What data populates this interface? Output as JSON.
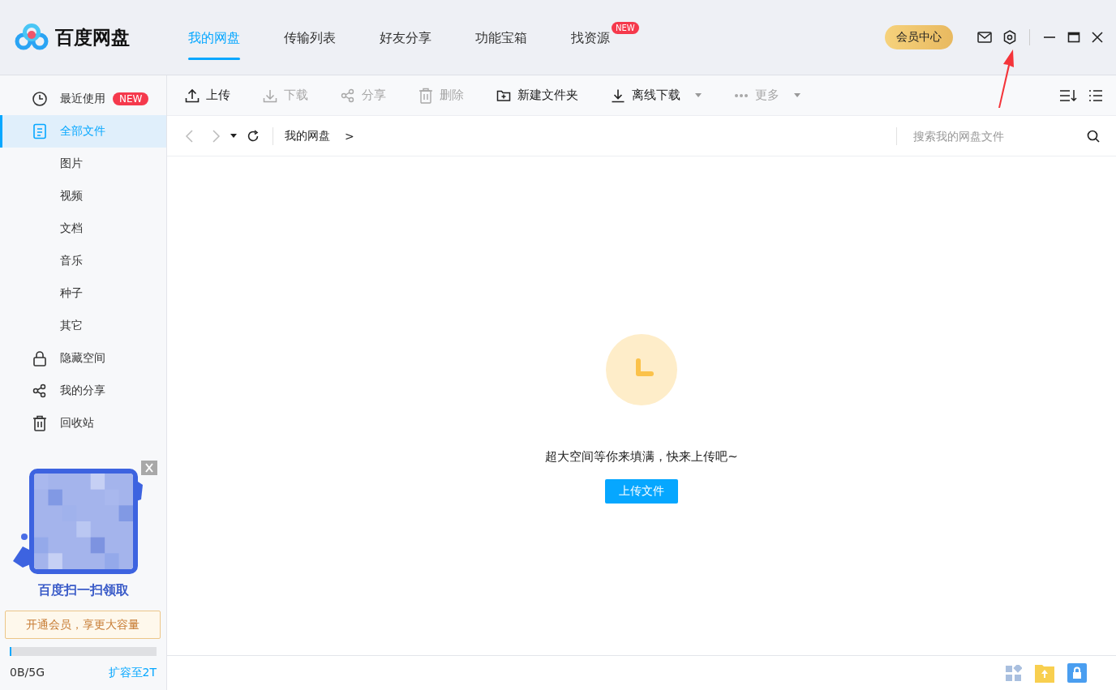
{
  "app": {
    "name": "百度网盘"
  },
  "tabs": [
    {
      "label": "我的网盘",
      "selected": true
    },
    {
      "label": "传输列表",
      "selected": false
    },
    {
      "label": "好友分享",
      "selected": false
    },
    {
      "label": "功能宝箱",
      "selected": false
    },
    {
      "label": "找资源",
      "selected": false,
      "badge": "NEW"
    }
  ],
  "header": {
    "vip_button": "会员中心"
  },
  "sidebar": {
    "items": [
      {
        "kind": "recent",
        "label": "最近使用",
        "selected": false,
        "badge": "NEW"
      },
      {
        "kind": "all-files",
        "label": "全部文件",
        "selected": true,
        "children": [
          {
            "label": "图片",
            "selected": false
          },
          {
            "label": "视频",
            "selected": false
          },
          {
            "label": "文档",
            "selected": false
          },
          {
            "label": "音乐",
            "selected": false
          },
          {
            "label": "种子",
            "selected": false
          },
          {
            "label": "其它",
            "selected": false
          }
        ]
      },
      {
        "kind": "hidden-space",
        "label": "隐藏空间",
        "selected": false
      },
      {
        "kind": "my-share",
        "label": "我的分享",
        "selected": false
      },
      {
        "kind": "recycle-bin",
        "label": "回收站",
        "selected": false
      }
    ],
    "promo": {
      "lines": [
        "百度扫一扫领取"
      ],
      "toast": "开通会员，享更大容量"
    },
    "storage": {
      "level": 0.01,
      "usage": "0B/5G",
      "expand_link": "扩容至2T"
    }
  },
  "toolbar": {
    "buttons": [
      {
        "kind": "upload",
        "label": "上传",
        "disabled": false,
        "dropdown": false
      },
      {
        "kind": "download",
        "label": "下载",
        "disabled": true,
        "dropdown": false
      },
      {
        "kind": "share",
        "label": "分享",
        "disabled": true,
        "dropdown": false
      },
      {
        "kind": "delete",
        "label": "删除",
        "disabled": true,
        "dropdown": false
      },
      {
        "kind": "new-folder",
        "label": "新建文件夹",
        "disabled": false,
        "dropdown": false
      },
      {
        "kind": "offline-download",
        "label": "离线下载",
        "disabled": false,
        "dropdown": true
      },
      {
        "kind": "more",
        "label": "更多",
        "disabled": true,
        "dropdown": true
      }
    ]
  },
  "nav": {
    "path": "我的网盘",
    "separator": ">",
    "search": {
      "placeholder": "搜索我的网盘文件"
    }
  },
  "empty_state": {
    "message": "超大空间等你来填满，快来上传吧~",
    "button": "上传文件"
  }
}
